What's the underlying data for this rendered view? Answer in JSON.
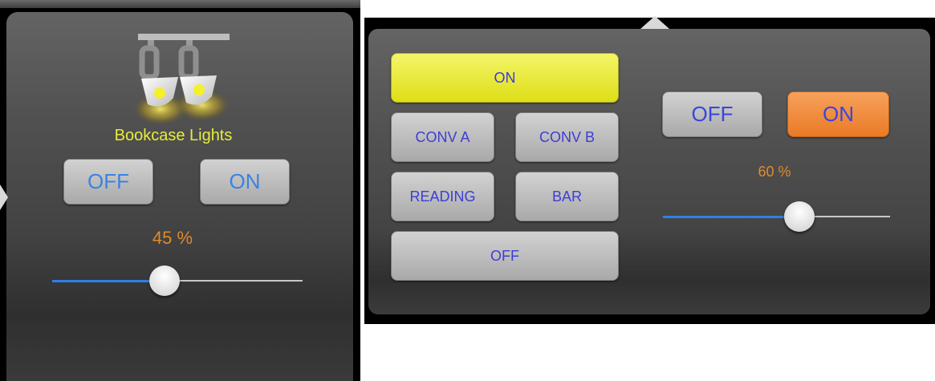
{
  "left_panel": {
    "device_name": "Bookcase Lights",
    "icon": "track-light-icon",
    "off_label": "OFF",
    "on_label": "ON",
    "level_text": "45 %",
    "level_percent": 45
  },
  "right_panel": {
    "scenes": {
      "on": "ON",
      "conv_a": "CONV A",
      "conv_b": "CONV B",
      "reading": "READING",
      "bar": "BAR",
      "off": "OFF"
    },
    "off_label": "OFF",
    "on_label": "ON",
    "level_text": "60 %",
    "level_percent": 60
  },
  "colors": {
    "device_name": "#e6ec3c",
    "level_text": "#e0892e",
    "button_text_left": "#3a83e3",
    "button_text_right": "#3845e0",
    "scene_on_active": "#f2f24a",
    "power_on_active": "#f08c3a",
    "slider_fill": "#2f80e5"
  }
}
